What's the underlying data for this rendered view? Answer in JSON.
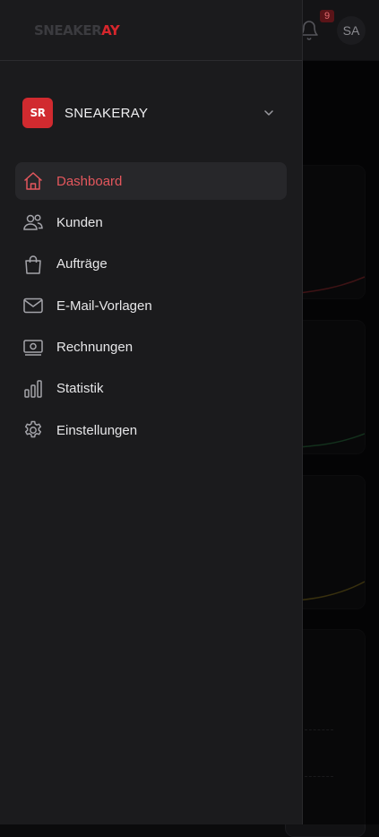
{
  "app": {
    "notification_count": "9",
    "user_initials": "SA"
  },
  "logo": {
    "part1": "SNEAKER",
    "part2": "AY"
  },
  "workspace": {
    "badge": "SR",
    "name": "SNEAKERAY"
  },
  "nav": {
    "items": [
      {
        "label": "Dashboard",
        "icon": "home-icon",
        "active": true
      },
      {
        "label": "Kunden",
        "icon": "users-icon"
      },
      {
        "label": "Aufträge",
        "icon": "shopping-bag-icon"
      },
      {
        "label": "E-Mail-Vorlagen",
        "icon": "mail-icon"
      },
      {
        "label": "Rechnungen",
        "icon": "invoice-icon"
      },
      {
        "label": "Statistik",
        "icon": "bar-chart-icon"
      },
      {
        "label": "Einstellungen",
        "icon": "settings-icon"
      }
    ]
  },
  "colors": {
    "accent": "#e4575d",
    "brand_red": "#d12a2f",
    "drawer_bg": "#1b1b1d",
    "active_bg": "#27272a"
  }
}
